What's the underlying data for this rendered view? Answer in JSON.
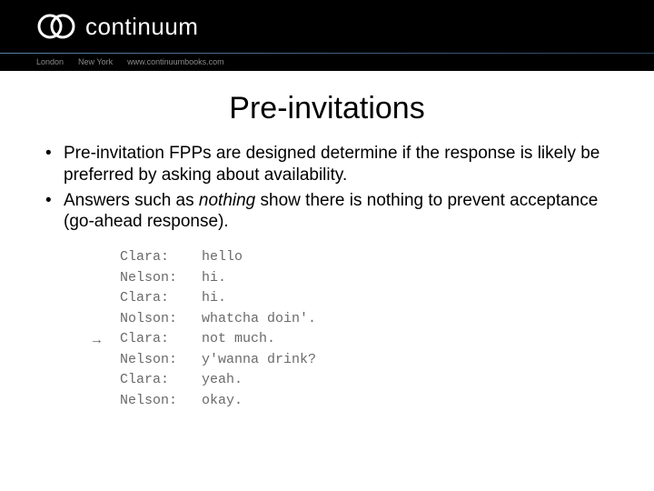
{
  "header": {
    "brand": "continuum",
    "cities": [
      "London",
      "New York"
    ],
    "url": "www.continuumbooks.com"
  },
  "slide": {
    "title": "Pre-invitations",
    "bullets": [
      {
        "text_parts": [
          "Pre-invitation FPPs are designed determine if the response is likely be preferred by asking about availability."
        ]
      },
      {
        "text_parts": [
          "Answers such as ",
          {
            "italic": "nothing"
          },
          " show there is nothing to prevent acceptance (go-ahead response)."
        ]
      }
    ],
    "dialogue": [
      {
        "speaker": "Clara:",
        "line": "hello"
      },
      {
        "speaker": "Nelson:",
        "line": "hi."
      },
      {
        "speaker": "Clara:",
        "line": "hi."
      },
      {
        "speaker": "Nolson:",
        "line": "whatcha doin'."
      },
      {
        "speaker": "Clara:",
        "line": "not much."
      },
      {
        "speaker": "Nelson:",
        "line": "y'wanna drink?"
      },
      {
        "speaker": "Clara:",
        "line": "yeah."
      },
      {
        "speaker": "Nelson:",
        "line": "okay."
      }
    ],
    "arrow_row_index": 4,
    "arrow_glyph": "→"
  }
}
